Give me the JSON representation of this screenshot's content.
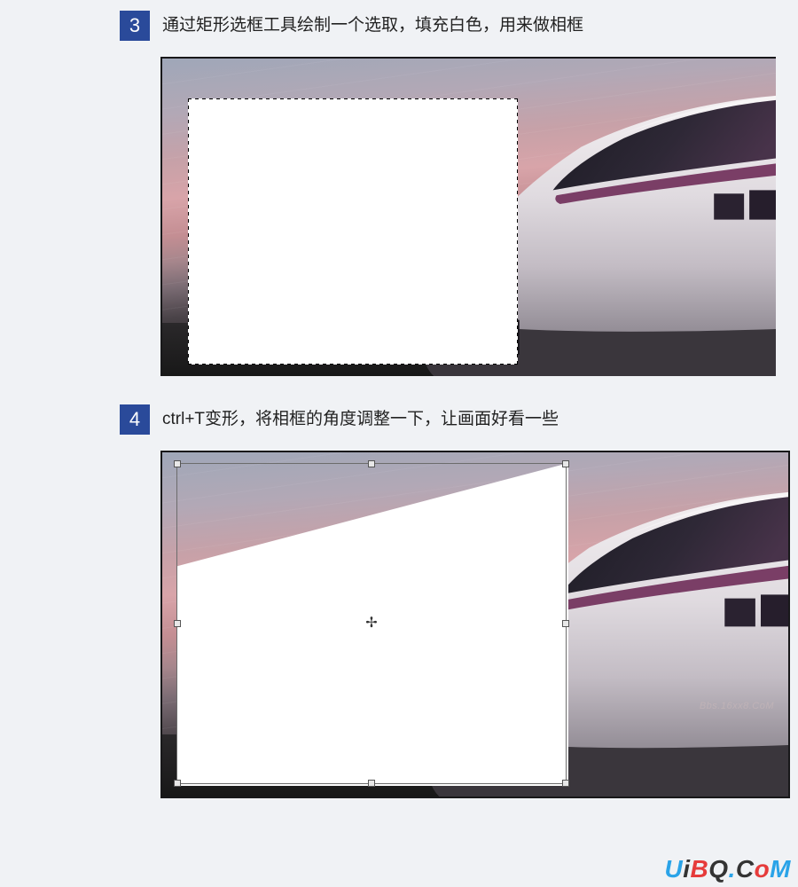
{
  "steps": [
    {
      "number": "3",
      "text": "通过矩形选框工具绘制一个选取，填充白色，用来做相框"
    },
    {
      "number": "4",
      "text": "ctrl+T变形，将相框的角度调整一下，让画面好看一些"
    }
  ],
  "watermark_small": "Bbs.16xx8.CoM",
  "watermark_big": {
    "u": "U",
    "i": "i",
    "b": "B",
    "q": "Q",
    "dot": ".",
    "c": "C",
    "o": "o",
    "mm": "M"
  },
  "colors": {
    "step_badge_bg": "#2a4a9a",
    "page_bg": "#f0f2f5"
  }
}
